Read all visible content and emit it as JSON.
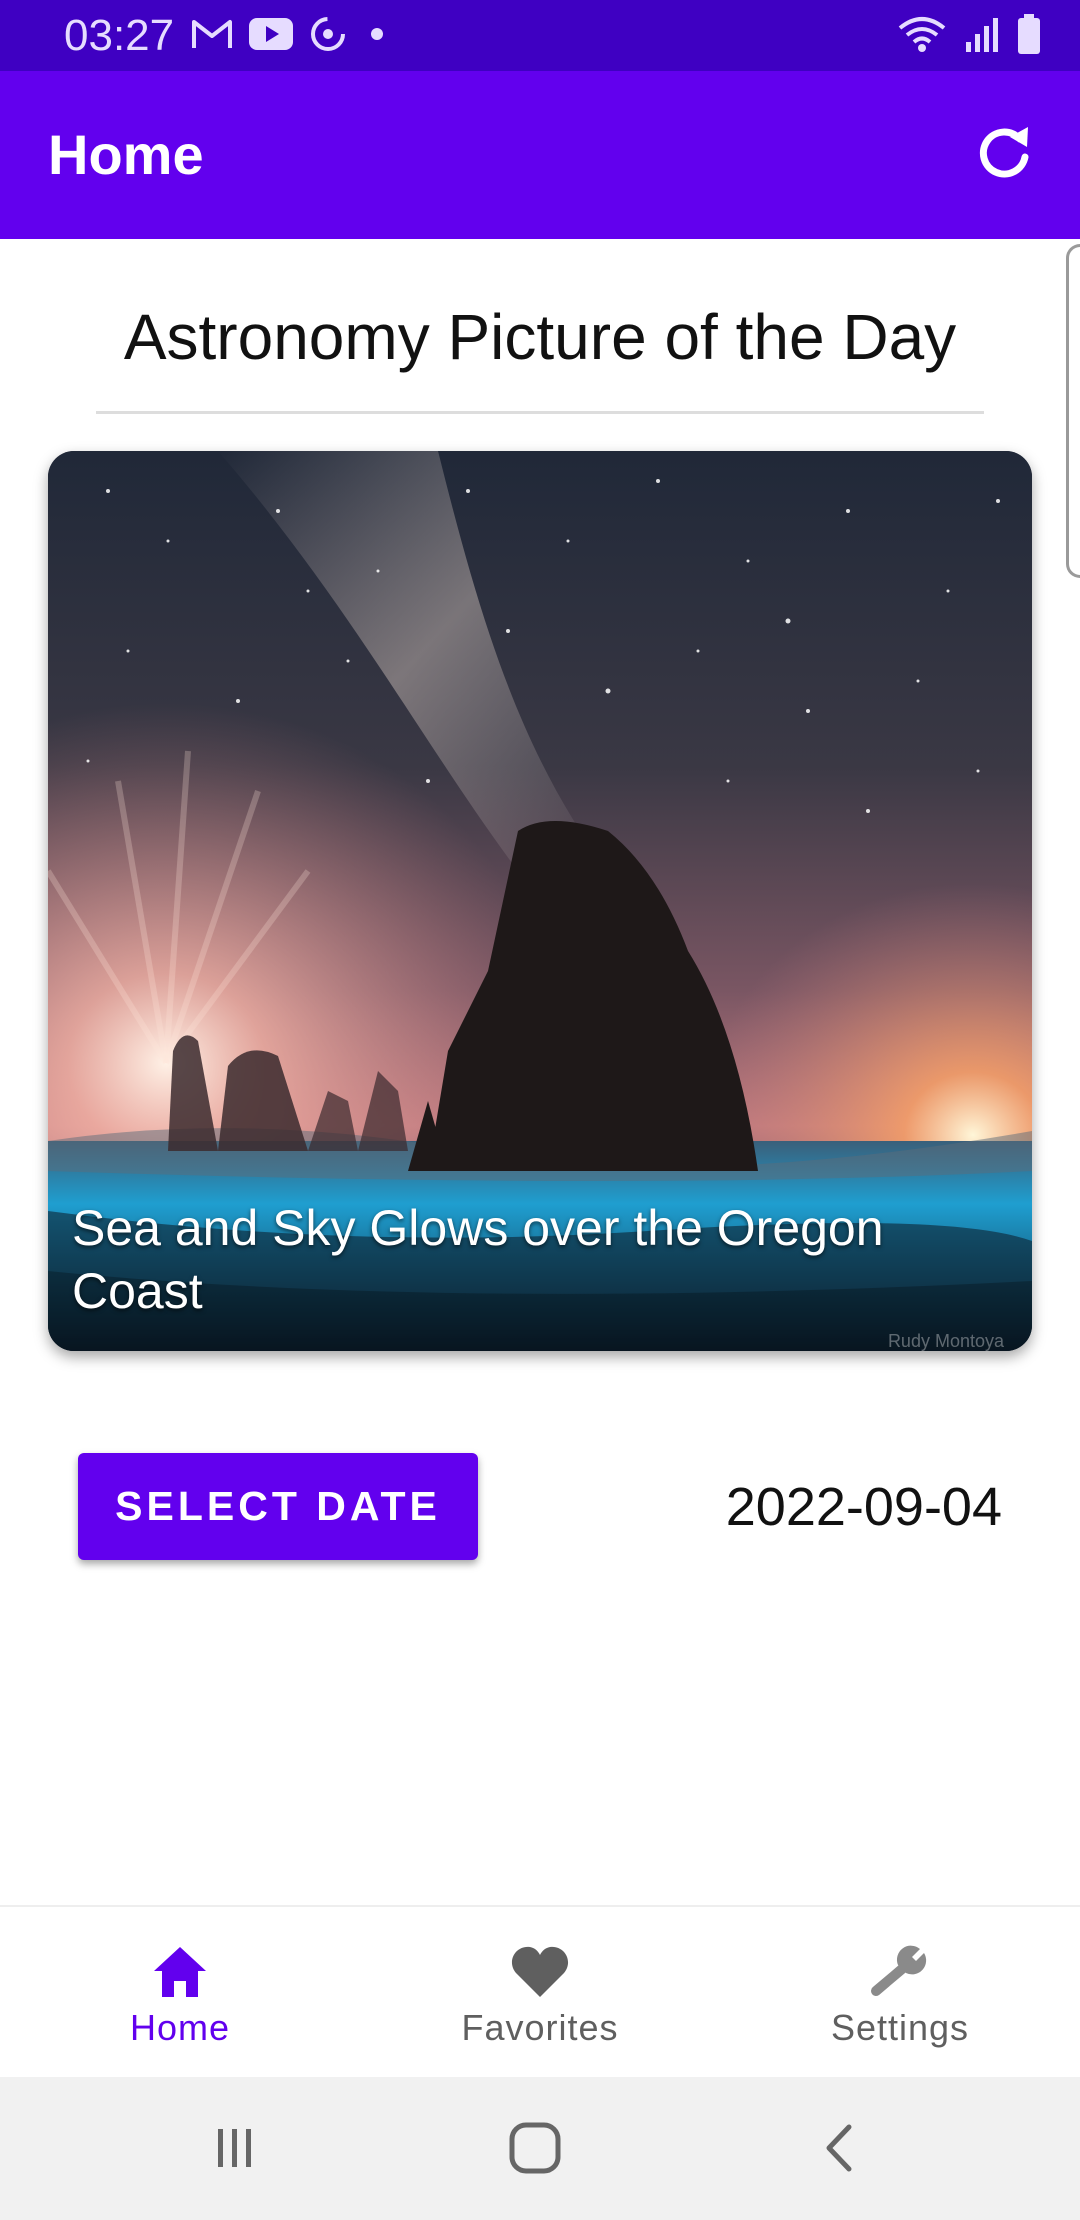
{
  "status_bar": {
    "time": "03:27",
    "left_icons": [
      "gmail-icon",
      "youtube-icon",
      "sync-icon",
      "dot-icon"
    ],
    "right_icons": [
      "wifi-icon",
      "signal-icon",
      "battery-icon"
    ]
  },
  "app_bar": {
    "title": "Home",
    "refresh_icon": "refresh-icon"
  },
  "content": {
    "heading": "Astronomy Picture of the Day",
    "apod": {
      "caption": "Sea and Sky Glows over the Oregon Coast",
      "credit": "Rudy Montoya"
    },
    "select_date_label": "SELECT DATE",
    "date": "2022-09-04"
  },
  "bottom_nav": {
    "items": [
      {
        "label": "Home",
        "icon": "home-icon",
        "active": true
      },
      {
        "label": "Favorites",
        "icon": "heart-icon",
        "active": false
      },
      {
        "label": "Settings",
        "icon": "wrench-icon",
        "active": false
      }
    ]
  },
  "colors": {
    "primary": "#6200ee",
    "status_bar": "#3f00c2",
    "inactive": "#5f5f5f"
  }
}
